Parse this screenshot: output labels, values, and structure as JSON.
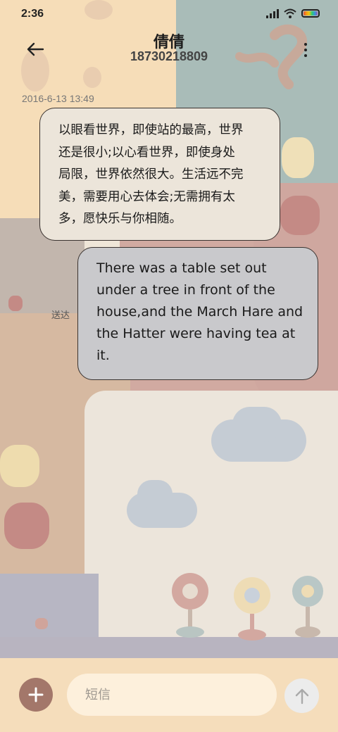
{
  "status_bar": {
    "time": "2:36",
    "icons": [
      "signal-icon",
      "wifi-icon",
      "battery-icon"
    ]
  },
  "header": {
    "contact_name": "倩倩",
    "phone_number": "18730218809",
    "back_icon": "arrow-left-icon",
    "more_icon": "more-vertical-icon"
  },
  "conversation": {
    "timestamp": "2016-6-13 13:49",
    "messages": [
      {
        "direction": "incoming",
        "lines": [
          "以眼看世界，即使站的最高，世界",
          "还是很小;以心看世界，即使身处",
          "局限，世界依然很大。生活远不完",
          "美，需要用心去体会;无需拥有太",
          "多，愿快乐与你相随。"
        ]
      },
      {
        "direction": "outgoing",
        "lines": [
          "There was a table set out",
          "under a tree in front of the",
          "house,and the March Hare and",
          "the Hatter were having tea at",
          "it."
        ],
        "status": "送达"
      }
    ]
  },
  "compose": {
    "placeholder": "短信",
    "add_icon": "plus-icon",
    "send_icon": "arrow-up-icon"
  },
  "colors": {
    "incoming_bubble": "#ece5da",
    "outgoing_bubble": "#c9c9cc",
    "compose_bar": "#f5ddbb",
    "add_button": "#a3776a"
  }
}
